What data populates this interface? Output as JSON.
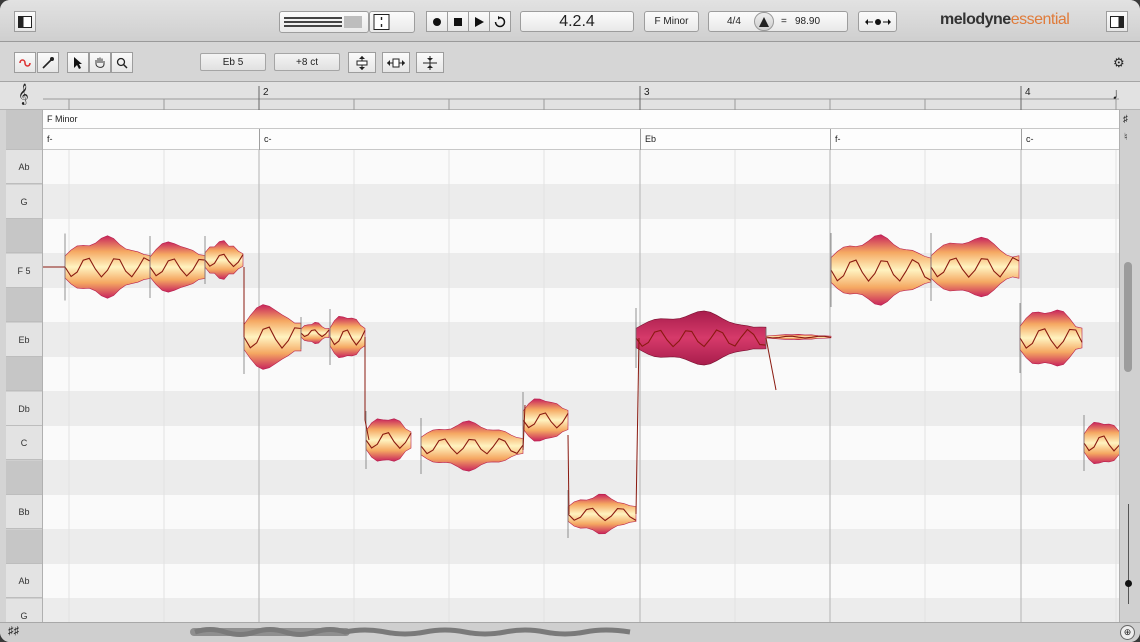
{
  "transport": {
    "position": "4.2.4",
    "key": "F Minor",
    "time_signature": "4/4",
    "tempo_equals": "=",
    "tempo": "98.90",
    "logo_main": "melodyne",
    "logo_sub": "essential",
    "icons": {
      "left_panel": "left-panel-toggle-icon",
      "record": "record-icon",
      "stop": "stop-icon",
      "play": "play-icon",
      "loop": "loop-icon",
      "metronome": "metronome-icon",
      "tempo_detect": "tempo-detect-icon",
      "right_panel": "right-panel-toggle-icon"
    }
  },
  "toolbar": {
    "note_pitch": "Eb 5",
    "cent_offset": "+8 ct",
    "tools": [
      "link-icon",
      "macro-tool-icon",
      "pointer-tool-icon",
      "hand-tool-icon",
      "zoom-tool-icon",
      "pitch-tool-icon",
      "timing-tool-icon",
      "separation-tool-icon",
      "gear-icon"
    ]
  },
  "ruler": {
    "bars": [
      "2",
      "3",
      "4"
    ]
  },
  "key_row": "F Minor",
  "chords": [
    {
      "label": "f-"
    },
    {
      "label": "c-"
    },
    {
      "label": "Eb"
    },
    {
      "label": "f-"
    },
    {
      "label": "c-"
    }
  ],
  "pitch_ruler": [
    {
      "label": "",
      "type": "black"
    },
    {
      "label": "Ab",
      "type": "white"
    },
    {
      "label": "G",
      "type": "white"
    },
    {
      "label": "",
      "type": "black"
    },
    {
      "label": "F 5",
      "type": "white"
    },
    {
      "label": "",
      "type": "black"
    },
    {
      "label": "Eb",
      "type": "white"
    },
    {
      "label": "",
      "type": "black"
    },
    {
      "label": "Db",
      "type": "white"
    },
    {
      "label": "C",
      "type": "white"
    },
    {
      "label": "",
      "type": "black"
    },
    {
      "label": "Bb",
      "type": "white"
    },
    {
      "label": "",
      "type": "black"
    },
    {
      "label": "Ab",
      "type": "white"
    },
    {
      "label": "G",
      "type": "white"
    }
  ],
  "colors": {
    "blob_core": "#fff3c0",
    "blob_mid": "#f5a862",
    "blob_edge": "#c8245c",
    "pitch_curve": "#8a1a10",
    "selected_blob": "#c22a5a"
  }
}
